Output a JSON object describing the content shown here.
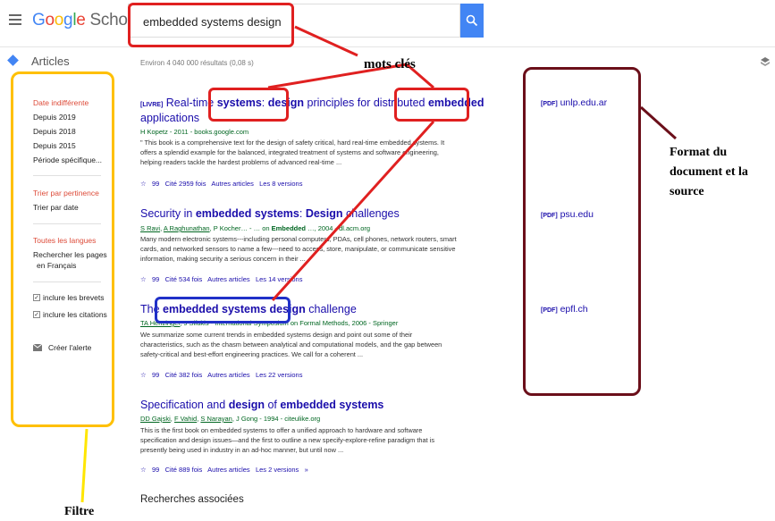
{
  "header": {
    "logo_text": "Google Scholar",
    "search_value": "embedded systems design",
    "search_icon": "search-icon",
    "menu_icon": "hamburger-menu-icon"
  },
  "subbar": {
    "articles_label": "Articles",
    "results_count": "Environ 4 040 000 résultats (0,08 s)"
  },
  "sidebar": {
    "date_filters": [
      "Date indifférente",
      "Depuis 2019",
      "Depuis 2018",
      "Depuis 2015",
      "Période spécifique..."
    ],
    "sort_filters": [
      "Trier par pertinence",
      "Trier par date"
    ],
    "language_filters": [
      "Toutes les langues",
      "Rechercher les pages",
      "en Français"
    ],
    "checkboxes": [
      "inclure les brevets",
      "inclure les citations"
    ],
    "alert_label": "Créer l'alerte"
  },
  "results": [
    {
      "type": "[LIVRE]",
      "title_parts": [
        "Real-time ",
        "systems",
        ": ",
        "design",
        " principles for distributed ",
        "embedded"
      ],
      "title_line2": "applications",
      "meta": "H Kopetz - 2011 - books.google.com",
      "snippet": "\" This book is a comprehensive text for the design of safety critical, hard real-time embedded systems. It offers a splendid example for the balanced, integrated treatment of systems and software engineering, helping readers tackle the hardest problems of advanced real-time ...",
      "cited": "Cité 2959 fois",
      "related": "Autres articles",
      "versions": "Les 8 versions",
      "side": "[PDF]",
      "side_source": "unlp.edu.ar"
    },
    {
      "type": "",
      "title_parts": [
        "Security in ",
        "embedded systems",
        ": ",
        "Design",
        " challenges"
      ],
      "title_line2": "",
      "meta_parts": [
        "S Ravi",
        ", ",
        "A Raghunathan",
        ", P Kocher… - … on ",
        "Embedded",
        " …, 2004 - dl.acm.org"
      ],
      "snippet": "Many modern electronic systems---including personal computers, PDAs, cell phones, network routers, smart cards, and networked sensors to name a few---need to access, store, manipulate, or communicate sensitive information, making security a serious concern in their ...",
      "cited": "Cité 534 fois",
      "related": "Autres articles",
      "versions": "Les 14 versions",
      "side": "[PDF]",
      "side_source": "psu.edu"
    },
    {
      "type": "",
      "title_parts": [
        "The ",
        "embedded systems design",
        " challenge"
      ],
      "title_line2": "",
      "meta_parts": [
        "TA Henzinger",
        ", J Sifakis - International Symposium on Formal Methods, 2006 - Springer"
      ],
      "snippet": "We summarize some current trends in embedded systems design and point out some of their characteristics, such as the chasm between analytical and computational models, and the gap between safety-critical and best-effort engineering practices. We call for a coherent ...",
      "cited": "Cité 382 fois",
      "related": "Autres articles",
      "versions": "Les 22 versions",
      "side": "[PDF]",
      "side_source": "epfl.ch"
    },
    {
      "type": "",
      "title_parts": [
        "Specification and ",
        "design",
        " of ",
        "embedded systems"
      ],
      "title_line2": "",
      "meta_parts": [
        "DD Gajski",
        ", ",
        "F Vahid",
        ", ",
        "S Narayan",
        ", J Gong - 1994 - citeulike.org"
      ],
      "snippet": "This is the first book on embedded systems to offer a unified approach to hardware and software specification and design issues—and the first to outline a new specify-explore-refine paradigm that is presently being used in industry in an ad-hoc manner, but until now ...",
      "cited": "Cité 889 fois",
      "related": "Autres articles",
      "versions": "Les 2 versions",
      "side": "",
      "side_source": ""
    }
  ],
  "related_searches": "Recherches associées",
  "annotations": {
    "keywords": "mots clés",
    "format_line1": "Format du",
    "format_line2": "document  et la",
    "format_line3": "source",
    "filter": "Filtre"
  },
  "colors": {
    "accent_blue": "#4285f4",
    "link_blue": "#1a0dab",
    "filter_red": "#dd4b39",
    "source_green": "#006621",
    "annotation_red": "#e02020",
    "annotation_darkred": "#6b0f1a",
    "annotation_blue": "#2030c8",
    "annotation_yellow": "#ffc000"
  }
}
